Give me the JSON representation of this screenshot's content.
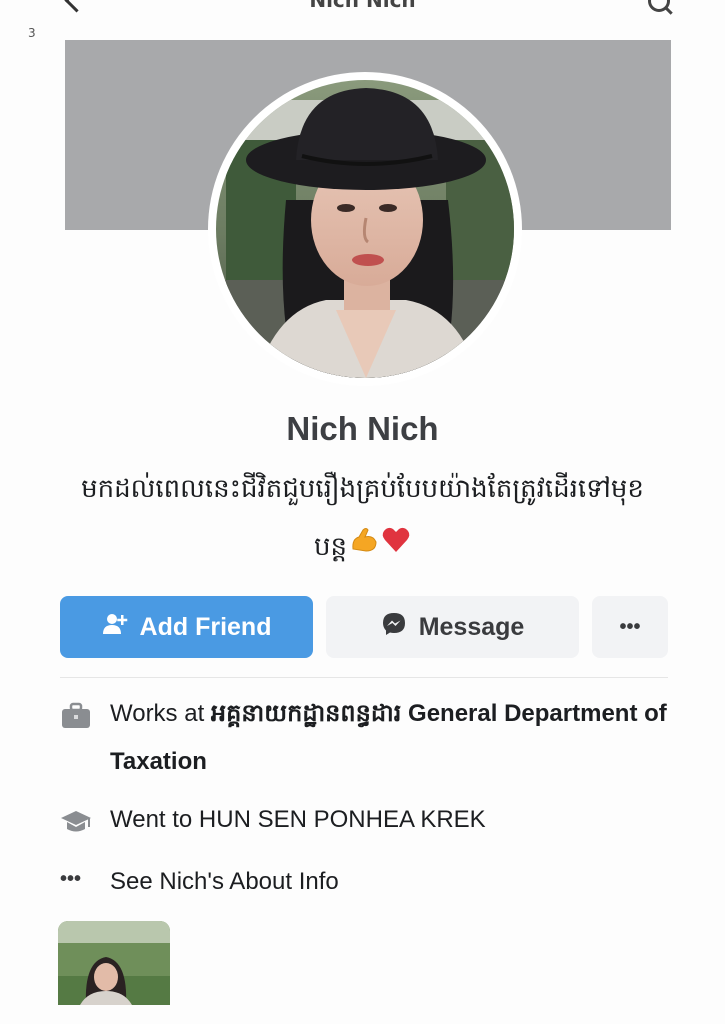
{
  "header": {
    "title": "Nich Nich"
  },
  "page_number": "3",
  "profile": {
    "name": "Nich Nich",
    "bio_line1": "មកដល់ពេលនេះជីវិតជួបរឿងគ្រប់បែបយ៉ាងតែត្រូវដើរទៅមុខ",
    "bio_line2": "បន្ត",
    "bio_emoji_icons": [
      "flexed-biceps-icon",
      "red-heart-icon"
    ]
  },
  "actions": {
    "add_friend_label": "Add Friend",
    "message_label": "Message",
    "more_label": "•••"
  },
  "intro": {
    "work": {
      "prefix": "Works at ",
      "employer_khmer": "អគ្គនាយកដ្ឋានពន្ធដារ",
      "employer_en": "General Department of Taxation",
      "icon": "briefcase-icon"
    },
    "education": {
      "text": "Went to HUN SEN PONHEA KREK",
      "icon": "graduation-cap-icon"
    },
    "about": {
      "text": "See Nich's About Info",
      "icon": "more-dots-icon"
    }
  },
  "colors": {
    "add_friend_bg": "#4a9ae3",
    "secondary_btn_bg": "#f2f3f5",
    "cover_gray": "#a8a9ab"
  }
}
